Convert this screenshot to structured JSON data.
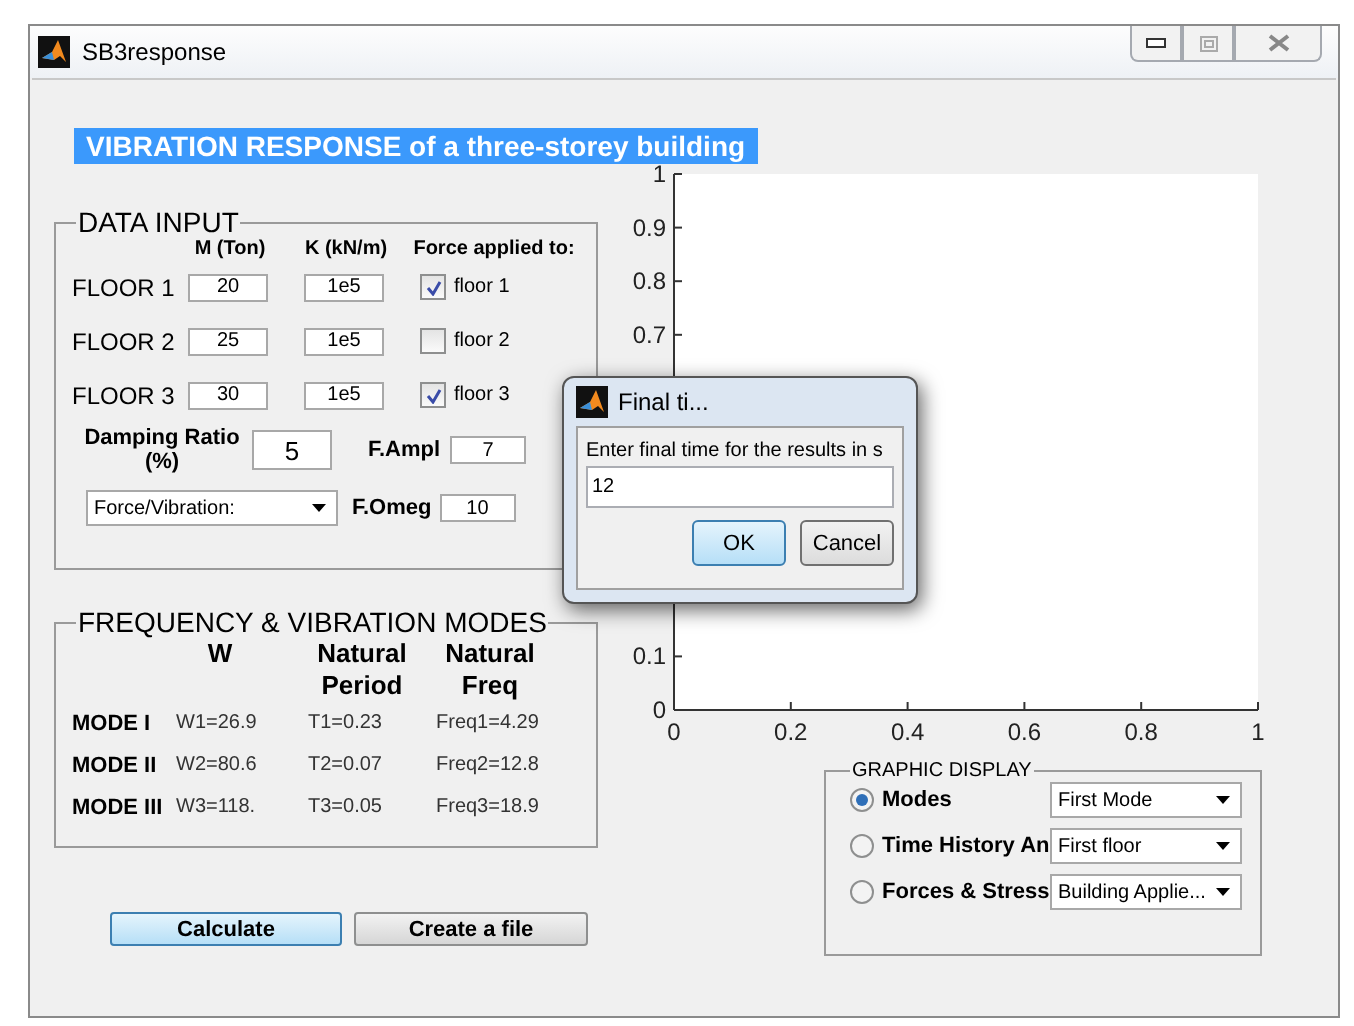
{
  "window": {
    "title": "SB3response"
  },
  "banner": {
    "title": "VIBRATION RESPONSE of a three-storey building"
  },
  "data_input": {
    "title": "DATA INPUT",
    "columns": [
      "M (Ton)",
      "K (kN/m)",
      "Force applied to:"
    ],
    "floors": [
      {
        "label": "FLOOR 1",
        "mass": "20",
        "stiffness": "1e5",
        "force_label": "floor 1",
        "checked": true
      },
      {
        "label": "FLOOR 2",
        "mass": "25",
        "stiffness": "1e5",
        "force_label": "floor 2",
        "checked": false
      },
      {
        "label": "FLOOR 3",
        "mass": "30",
        "stiffness": "1e5",
        "force_label": "floor 3",
        "checked": true
      }
    ],
    "damping": {
      "label": "Damping Ratio (%)",
      "value": "5"
    },
    "amplitude": {
      "label": "F.Ampl",
      "value": "7"
    },
    "force_dropdown": {
      "value": "Force/Vibration:"
    },
    "omega": {
      "label": "F.Omeg",
      "value": "10"
    }
  },
  "modes": {
    "title": "FREQUENCY & VIBRATION MODES",
    "columns": [
      "W",
      "Natural Period",
      "Natural Freq"
    ],
    "rows": [
      {
        "label": "MODE I",
        "w": "W1=26.9",
        "t": "T1=0.23",
        "freq": "Freq1=4.29"
      },
      {
        "label": "MODE II",
        "w": "W2=80.6",
        "t": "T2=0.07",
        "freq": "Freq2=12.8"
      },
      {
        "label": "MODE III",
        "w": "W3=118.",
        "t": "T3=0.05",
        "freq": "Freq3=18.9"
      }
    ]
  },
  "buttons": [
    {
      "label": "Calculate",
      "default": true
    },
    {
      "label": "Create a file",
      "default": false
    }
  ],
  "chart": {
    "chart_data": {
      "type": "line",
      "xlim": [
        0,
        1
      ],
      "ylim": [
        0,
        1
      ],
      "xticks": [
        0,
        0.2,
        0.4,
        0.6,
        0.8,
        1
      ],
      "yticks": [
        0,
        0.1,
        0.7,
        0.8,
        0.9,
        1
      ]
    }
  },
  "graphic_display": {
    "title": "GRAPHIC DISPLAY",
    "options": [
      {
        "label": "Modes",
        "selected": true,
        "dropdown": "First Mode"
      },
      {
        "label": "Time History An",
        "selected": false,
        "dropdown": "First floor"
      },
      {
        "label": "Forces & Stress",
        "selected": false,
        "dropdown": "Building Applie..."
      }
    ]
  },
  "dialog": {
    "title": "Final ti...",
    "prompt": "Enter final time for the results in s",
    "value": "12",
    "buttons": [
      {
        "label": "OK",
        "default": true
      },
      {
        "label": "Cancel",
        "default": false
      }
    ]
  }
}
